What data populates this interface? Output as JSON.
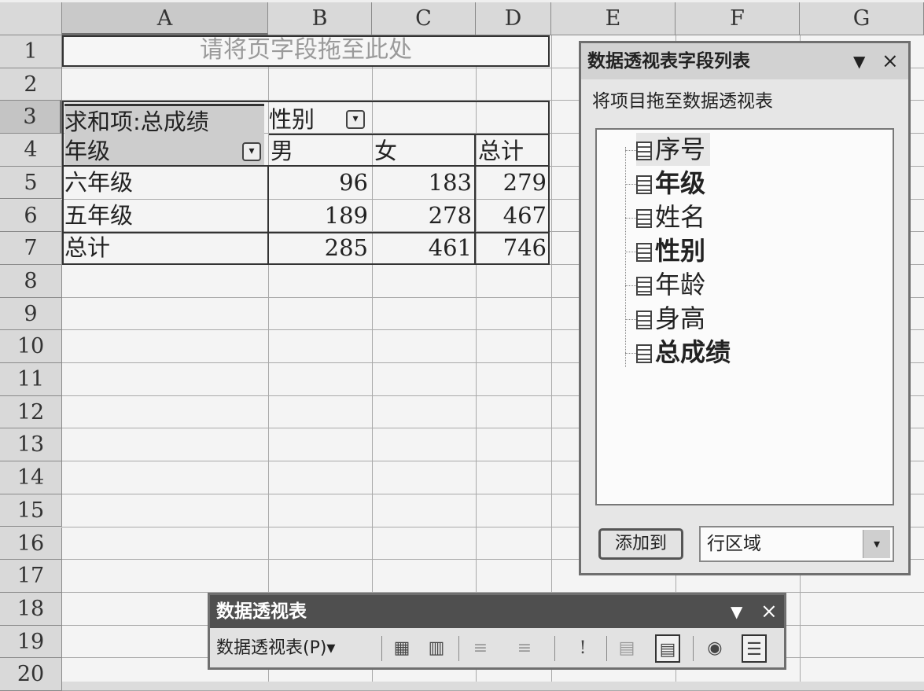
{
  "columns": [
    "A",
    "B",
    "C",
    "D",
    "E",
    "F",
    "G"
  ],
  "rows": [
    "1",
    "2",
    "3",
    "4",
    "5",
    "6",
    "7",
    "8",
    "9",
    "10",
    "11",
    "12",
    "13",
    "14",
    "15",
    "16",
    "17",
    "18",
    "19",
    "20"
  ],
  "pivot": {
    "page_drop_hint": "请将页字段拖至此处",
    "data_field": "求和项:总成绩",
    "column_field": "性别",
    "row_field": "年级",
    "col_items": [
      "男",
      "女",
      "总计"
    ],
    "row_items": [
      {
        "label": "六年级",
        "values": [
          "96",
          "183",
          "279"
        ]
      },
      {
        "label": "五年级",
        "values": [
          "189",
          "278",
          "467"
        ]
      },
      {
        "label": "总计",
        "values": [
          "285",
          "461",
          "746"
        ]
      }
    ]
  },
  "field_list": {
    "title": "数据透视表字段列表",
    "minimize": "▼",
    "close": "×",
    "instruction": "将项目拖至数据透视表",
    "fields": [
      {
        "label": "序号",
        "bold": false
      },
      {
        "label": "年级",
        "bold": true
      },
      {
        "label": "姓名",
        "bold": false
      },
      {
        "label": "性别",
        "bold": true
      },
      {
        "label": "年龄",
        "bold": false
      },
      {
        "label": "身高",
        "bold": false
      },
      {
        "label": "总成绩",
        "bold": true
      }
    ],
    "add_button": "添加到",
    "area_select": "行区域"
  },
  "toolbar": {
    "title": "数据透视表",
    "minimize": "▼",
    "close": "×",
    "menu": "数据透视表(P)▾",
    "icons": [
      "format-report-icon",
      "chart-wizard-icon",
      "hide-detail-icon",
      "show-detail-icon",
      "refresh-icon",
      "include-hidden-icon",
      "always-display-icon",
      "field-settings-icon",
      "field-list-icon"
    ]
  },
  "colors": {
    "background": "#dcdcdc",
    "header": "#d9d9d9",
    "toolbar_title": "#4f4f4f"
  }
}
